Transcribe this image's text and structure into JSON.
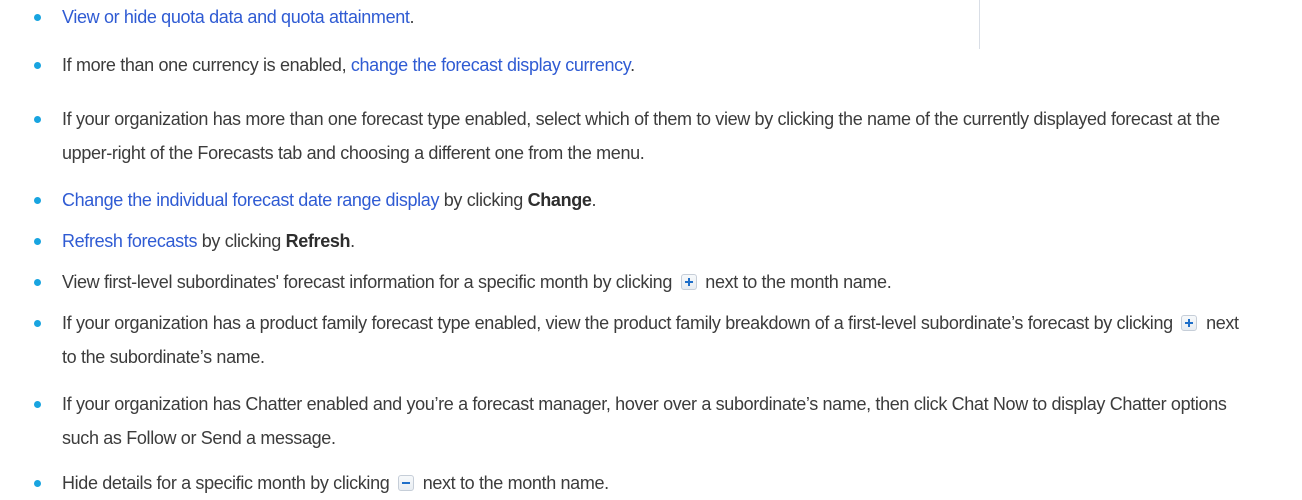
{
  "items": [
    {
      "link": "View or hide quota data and quota attainment",
      "after": "."
    },
    {
      "before": "If more than one currency is enabled, ",
      "link": "change the forecast display currency",
      "after": "."
    },
    {
      "text": "If your organization has more than one forecast type enabled, select which of them to view by clicking the name of the currently displayed forecast at the upper-right of the Forecasts tab and choosing a different one from the menu."
    },
    {
      "link": "Change the individual forecast date range display",
      "middle": " by clicking ",
      "bold": "Change",
      "after": "."
    },
    {
      "link": "Refresh forecasts",
      "middle": " by clicking ",
      "bold": "Refresh",
      "after": "."
    },
    {
      "before": "View first-level subordinates' forecast information for a specific month by clicking ",
      "icon": "expand-plus-icon",
      "after": " next to the month name."
    },
    {
      "before": "If your organization has a product family forecast type enabled, view the product family breakdown of a first-level subordinate’s forecast by clicking ",
      "icon": "expand-plus-icon",
      "after": " next to the subordinate’s name."
    },
    {
      "text": "If your organization has Chatter enabled and you’re a forecast manager, hover over a subordinate’s name, then click Chat Now to display Chatter options such as Follow or Send a message."
    },
    {
      "before": "Hide details for a specific month by clicking ",
      "icon": "collapse-minus-icon",
      "after": " next to the month name."
    }
  ],
  "colors": {
    "bullet": "#18a4e0",
    "link": "#2f5bd3",
    "text": "#3c3c3c",
    "icon": "#1f6fc9"
  }
}
